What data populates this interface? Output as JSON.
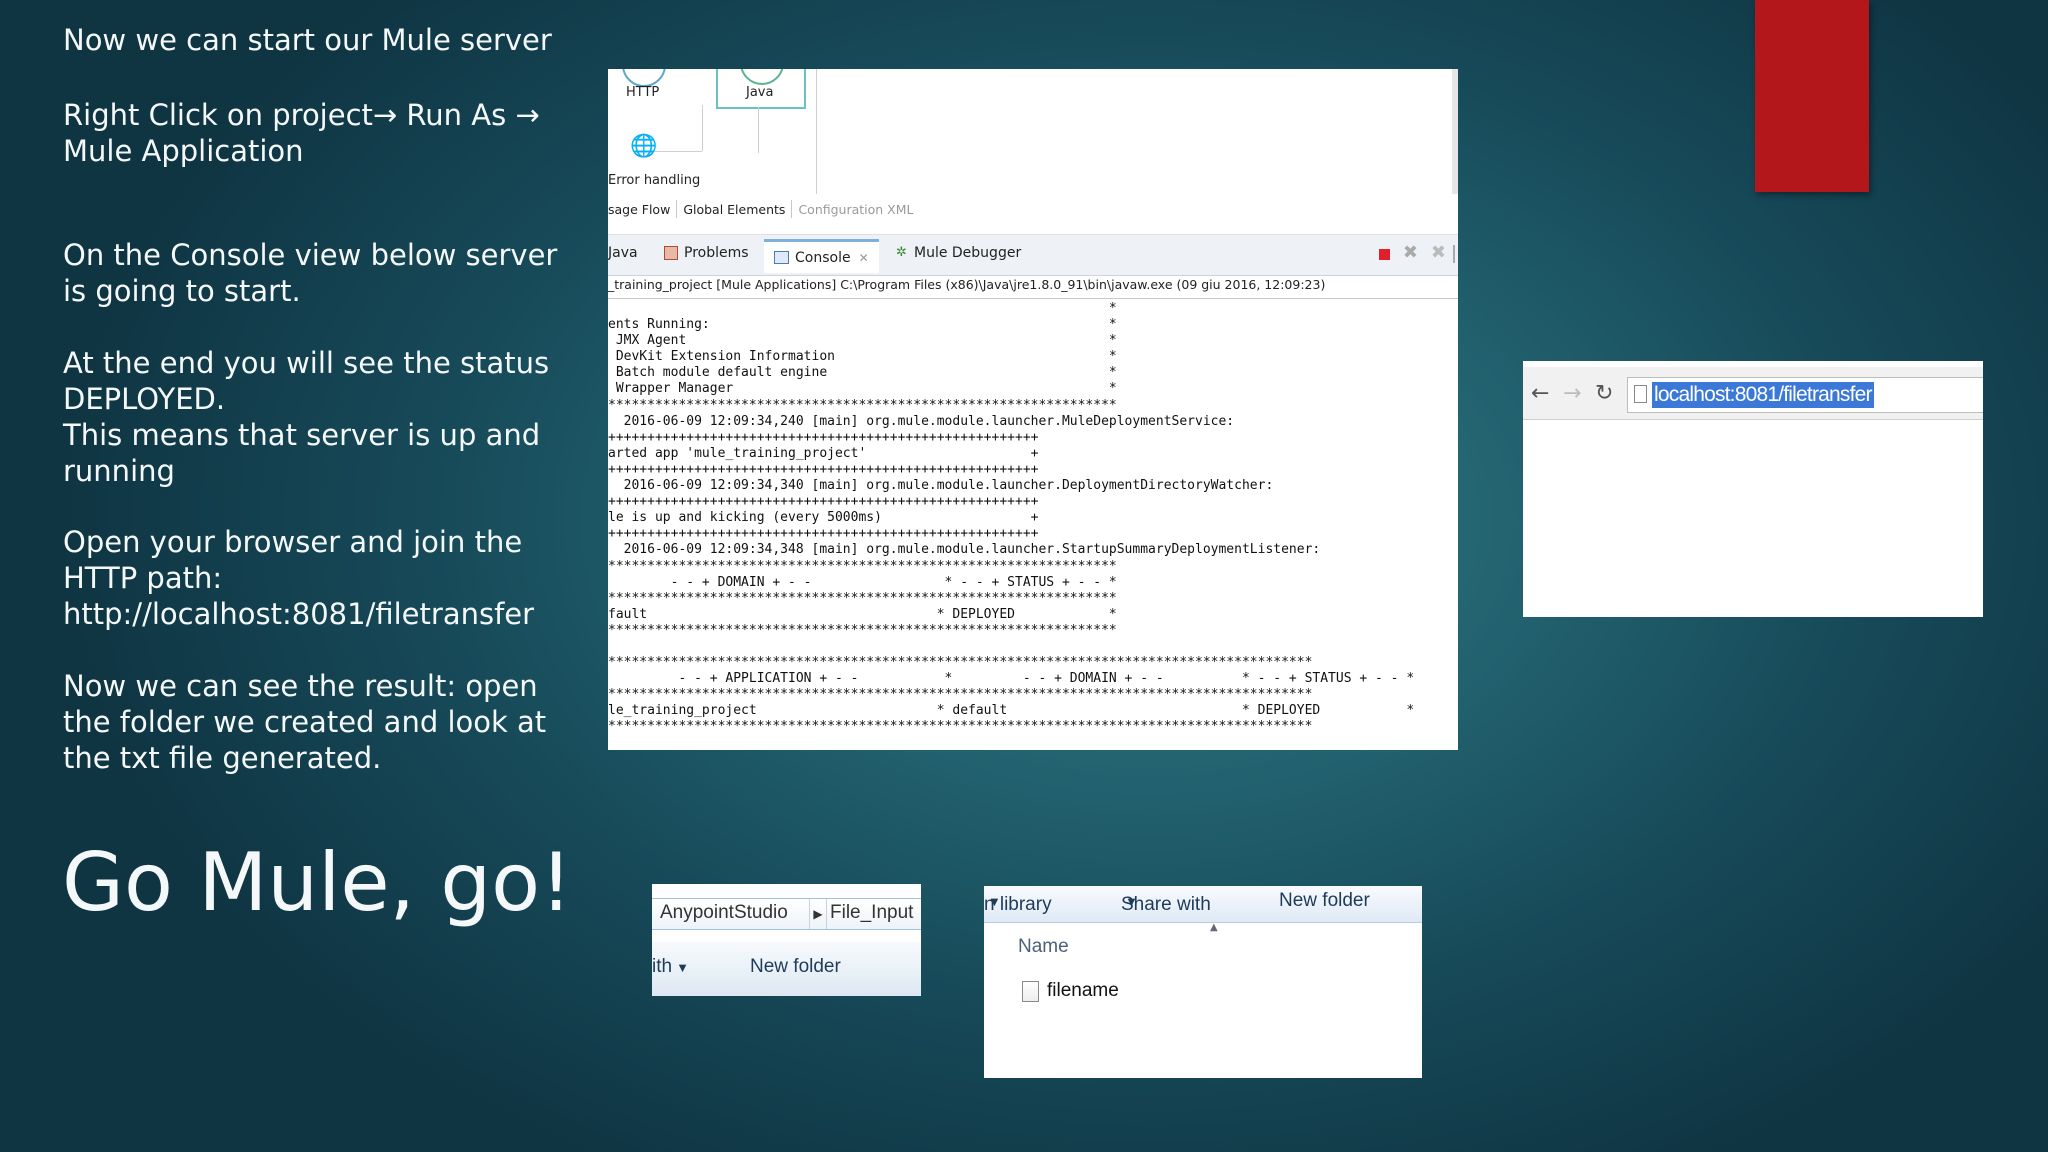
{
  "slide": {
    "text_lines": [
      "Now we can start our Mule server",
      "Right Click on project→ Run As →",
      "Mule Application",
      "On the Console view below server",
      "is going to start.",
      "At the end you will see the status",
      "DEPLOYED.",
      "This means that server is up and",
      "running",
      "Open your browser and join the",
      "HTTP path:",
      "http://localhost:8081/filetransfer",
      "Now we can see the result: open",
      "the folder we created and look at",
      "the txt file generated."
    ],
    "big_title": "Go Mule, go!",
    "accent_color": "#b3161b"
  },
  "ide": {
    "flow_nodes": [
      "HTTP",
      "Java"
    ],
    "error_handling_label": "Error handling",
    "editor_tabs": [
      "sage Flow",
      "Global Elements",
      "Configuration XML"
    ],
    "view_tabs": {
      "java": "Java",
      "problems": "Problems",
      "console": "Console",
      "debugger": "Mule Debugger"
    },
    "process_line": "_training_project [Mule Applications] C:\\Program Files (x86)\\Java\\jre1.8.0_91\\bin\\javaw.exe (09 giu 2016, 12:09:23)",
    "console_lines": [
      "                                                                *",
      "ents Running:                                                   *",
      " JMX Agent                                                      *",
      " DevKit Extension Information                                   *",
      " Batch module default engine                                    *",
      " Wrapper Manager                                                *",
      "*****************************************************************",
      "  2016-06-09 12:09:34,240 [main] org.mule.module.launcher.MuleDeploymentService:",
      "+++++++++++++++++++++++++++++++++++++++++++++++++++++++",
      "arted app 'mule_training_project'                     +",
      "+++++++++++++++++++++++++++++++++++++++++++++++++++++++",
      "  2016-06-09 12:09:34,340 [main] org.mule.module.launcher.DeploymentDirectoryWatcher:",
      "+++++++++++++++++++++++++++++++++++++++++++++++++++++++",
      "le is up and kicking (every 5000ms)                   +",
      "+++++++++++++++++++++++++++++++++++++++++++++++++++++++",
      "  2016-06-09 12:09:34,348 [main] org.mule.module.launcher.StartupSummaryDeploymentListener:",
      "*****************************************************************",
      "        - - + DOMAIN + - -                 * - - + STATUS + - - *",
      "*****************************************************************",
      "fault                                     * DEPLOYED            *",
      "*****************************************************************",
      "",
      "******************************************************************************************",
      "         - - + APPLICATION + - -           *         - - + DOMAIN + - -          * - - + STATUS + - - *",
      "******************************************************************************************",
      "le_training_project                       * default                              * DEPLOYED           *",
      "******************************************************************************************"
    ],
    "stop_color": "#e2202b"
  },
  "browser": {
    "url": "localhost:8081/filetransfer"
  },
  "explorer_breadcrumb": {
    "segments": [
      "AnypointStudio",
      "File_Input"
    ],
    "toolbar_left": "ith",
    "new_folder": "New folder"
  },
  "explorer_files": {
    "toolbar": {
      "library": "n library",
      "share": "Share with",
      "new_folder": "New folder"
    },
    "column_header": "Name",
    "files": [
      "filename"
    ]
  }
}
